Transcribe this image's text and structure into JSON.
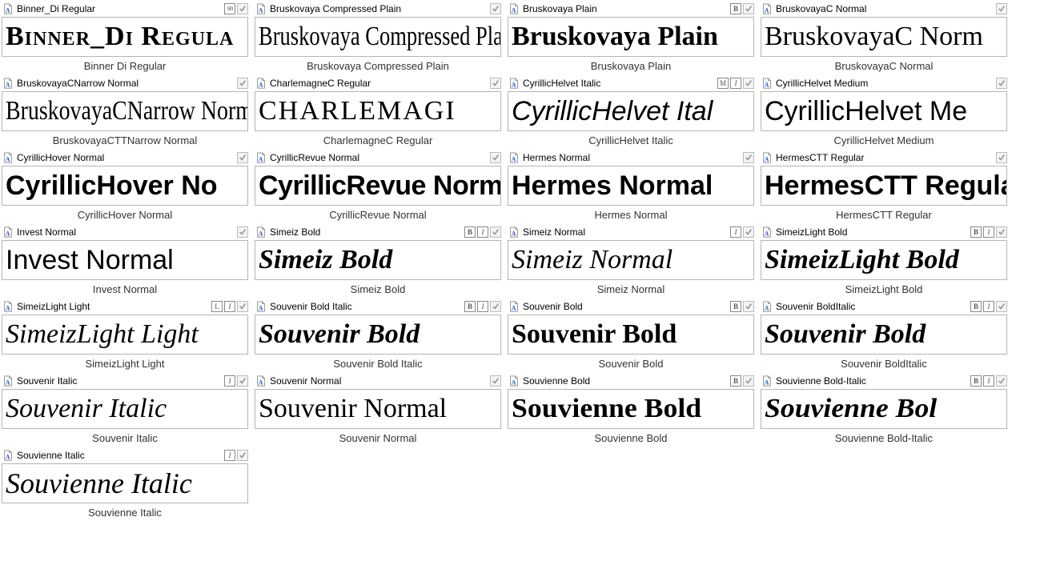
{
  "fonts": [
    {
      "title": "Binner_Di Regular",
      "preview": "Binner_Di Regula",
      "caption": "Binner Di Regular",
      "tags": [
        "SB"
      ],
      "cls": "pv-smallcaps"
    },
    {
      "title": "Bruskovaya Compressed Plain",
      "preview": "Bruskovaya Compressed Pla",
      "caption": "Bruskovaya Compressed Plain",
      "tags": [],
      "cls": "pv-condensed-serif"
    },
    {
      "title": "Bruskovaya Plain",
      "preview": "Bruskovaya Plain",
      "caption": "Bruskovaya Plain",
      "tags": [
        "B"
      ],
      "cls": "pv-slab"
    },
    {
      "title": "BruskovayaC Normal",
      "preview": "BruskovayaC Norm",
      "caption": "BruskovayaC Normal",
      "tags": [],
      "cls": "pv-serif"
    },
    {
      "title": "BruskovayaCNarrow Normal",
      "preview": "BruskovayaCNarrow Norma",
      "caption": "BruskovayaCTTNarrow Normal",
      "tags": [],
      "cls": "pv-narrow-serif"
    },
    {
      "title": "CharlemagneC Regular",
      "preview": "CHARLEMAGI",
      "caption": "CharlemagneC Regular",
      "tags": [],
      "cls": "pv-wide-serif"
    },
    {
      "title": "CyrillicHelvet Italic",
      "preview": "CyrillicHelvet Ital",
      "caption": "CyrillicHelvet Italic",
      "tags": [
        "M",
        "I"
      ],
      "cls": "pv-sans-italic"
    },
    {
      "title": "CyrillicHelvet Medium",
      "preview": "CyrillicHelvet Me",
      "caption": "CyrillicHelvet Medium",
      "tags": [],
      "cls": "pv-sans"
    },
    {
      "title": "CyrillicHover Normal",
      "preview": "CyrillicHover No",
      "caption": "CyrillicHover Normal",
      "tags": [],
      "cls": "pv-rounded"
    },
    {
      "title": "CyrillicRevue Normal",
      "preview": "CyrillicRevue Norm",
      "caption": "CyrillicRevue Normal",
      "tags": [],
      "cls": "pv-revue"
    },
    {
      "title": "Hermes Normal",
      "preview": "Hermes Normal",
      "caption": "Hermes Normal",
      "tags": [],
      "cls": "pv-hermes"
    },
    {
      "title": "HermesCTT Regular",
      "preview": "HermesCTT Regular",
      "caption": "HermesCTT Regular",
      "tags": [],
      "cls": "pv-hermes"
    },
    {
      "title": "Invest Normal",
      "preview": "Invest   Normal",
      "caption": "Invest Normal",
      "tags": [],
      "cls": "pv-invest"
    },
    {
      "title": "Simeiz Bold",
      "preview": "Simeiz  Bold",
      "caption": "Simeiz Bold",
      "tags": [
        "B",
        "I"
      ],
      "cls": "pv-simeiz-bold"
    },
    {
      "title": "Simeiz Normal",
      "preview": "Simeiz  Normal",
      "caption": "Simeiz Normal",
      "tags": [
        "I"
      ],
      "cls": "pv-simeiz"
    },
    {
      "title": "SimeizLight Bold",
      "preview": "SimeizLight  Bold",
      "caption": "SimeizLight Bold",
      "tags": [
        "B",
        "I"
      ],
      "cls": "pv-simeiz-bold"
    },
    {
      "title": "SimeizLight Light",
      "preview": "SimeizLight  Light",
      "caption": "SimeizLight Light",
      "tags": [
        "L",
        "I"
      ],
      "cls": "pv-simeiz-light"
    },
    {
      "title": "Souvenir Bold Italic",
      "preview": "Souvenir  Bold",
      "caption": "Souvenir Bold Italic",
      "tags": [
        "B",
        "I"
      ],
      "cls": "pv-souvenir-bi"
    },
    {
      "title": "Souvenir Bold",
      "preview": "Souvenir Bold",
      "caption": "Souvenir Bold",
      "tags": [
        "B"
      ],
      "cls": "pv-souvenir-b"
    },
    {
      "title": "Souvenir BoldItalic",
      "preview": "Souvenir Bold",
      "caption": "Souvenir BoldItalic",
      "tags": [
        "B",
        "I"
      ],
      "cls": "pv-souvenir-bi"
    },
    {
      "title": "Souvenir Italic",
      "preview": "Souvenir Italic",
      "caption": "Souvenir Italic",
      "tags": [
        "I"
      ],
      "cls": "pv-souvenir-i"
    },
    {
      "title": "Souvenir Normal",
      "preview": "Souvenir Normal",
      "caption": "Souvenir Normal",
      "tags": [],
      "cls": "pv-souvenir"
    },
    {
      "title": "Souvienne Bold",
      "preview": "Souvienne Bold",
      "caption": "Souvienne Bold",
      "tags": [
        "B"
      ],
      "cls": "pv-souvienne-b"
    },
    {
      "title": "Souvienne Bold-Italic",
      "preview": "Souvienne Bol",
      "caption": "Souvienne Bold-Italic",
      "tags": [
        "B",
        "I"
      ],
      "cls": "pv-souvienne-bi"
    },
    {
      "title": "Souvienne Italic",
      "preview": "Souvienne Italic",
      "caption": "Souvienne Italic",
      "tags": [
        "I"
      ],
      "cls": "pv-souvienne-i"
    }
  ]
}
